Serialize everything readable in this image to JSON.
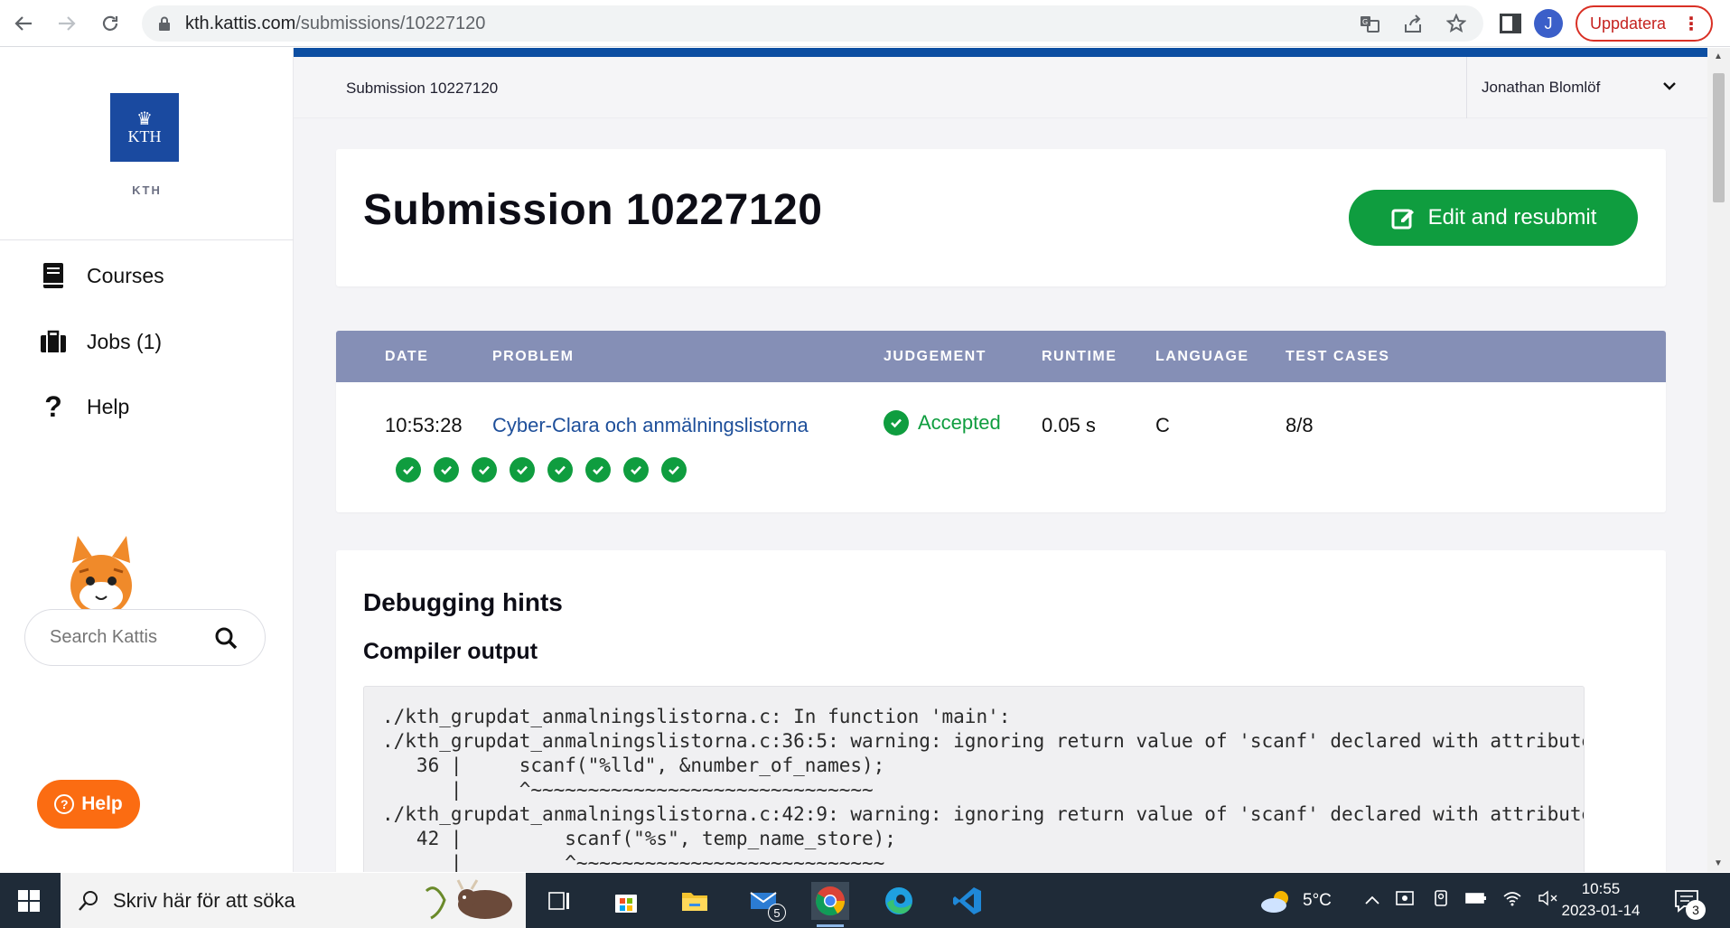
{
  "browser": {
    "url_domain": "kth.kattis.com",
    "url_path": "/submissions/10227120",
    "profile_initial": "J",
    "update_label": "Uppdatera"
  },
  "sidebar": {
    "logo_text": "KTH",
    "logo_caption": "KTH",
    "items": [
      {
        "label": "Courses",
        "icon": "book-icon"
      },
      {
        "label": "Jobs (1)",
        "icon": "briefcase-icon"
      },
      {
        "label": "Help",
        "icon": "question-icon"
      }
    ],
    "search_placeholder": "Search Kattis",
    "help_button": "Help"
  },
  "topbar": {
    "breadcrumb": "Submission 10227120",
    "user_name": "Jonathan Blomlöf"
  },
  "header": {
    "title": "Submission 10227120",
    "resubmit_label": "Edit and resubmit"
  },
  "submission_table": {
    "columns": [
      "DATE",
      "PROBLEM",
      "JUDGEMENT",
      "RUNTIME",
      "LANGUAGE",
      "TEST CASES"
    ],
    "row": {
      "date": "10:53:28",
      "problem": "Cyber-Clara och anmälningslistorna",
      "judgement": "Accepted",
      "runtime": "0.05 s",
      "language": "C",
      "test_cases": "8/8"
    },
    "passed_tests": 8
  },
  "debug": {
    "heading": "Debugging hints",
    "subheading": "Compiler output",
    "compiler_output": "./kth_grupdat_anmalningslistorna.c: In function 'main':\n./kth_grupdat_anmalningslistorna.c:36:5: warning: ignoring return value of 'scanf' declared with attribute 'warn_unused_result' [-Wunused-result]\n   36 |     scanf(\"%lld\", &number_of_names);\n      |     ^~~~~~~~~~~~~~~~~~~~~~~~~~~~~~~\n./kth_grupdat_anmalningslistorna.c:42:9: warning: ignoring return value of 'scanf' declared with attribute 'warn_unused_result' [-Wunused-result]\n   42 |         scanf(\"%s\", temp_name_store);\n      |         ^~~~~~~~~~~~~~~~~~~~~~~~~~~~"
  },
  "taskbar": {
    "search_placeholder": "Skriv här för att söka",
    "mail_badge": "5",
    "weather": "5°C",
    "time": "10:55",
    "date": "2023-01-14",
    "notification_count": "3"
  },
  "colors": {
    "accent_blue": "#0c4ea2",
    "success_green": "#0f9d3f",
    "table_header": "#858fb6",
    "help_orange": "#fb6c12"
  }
}
